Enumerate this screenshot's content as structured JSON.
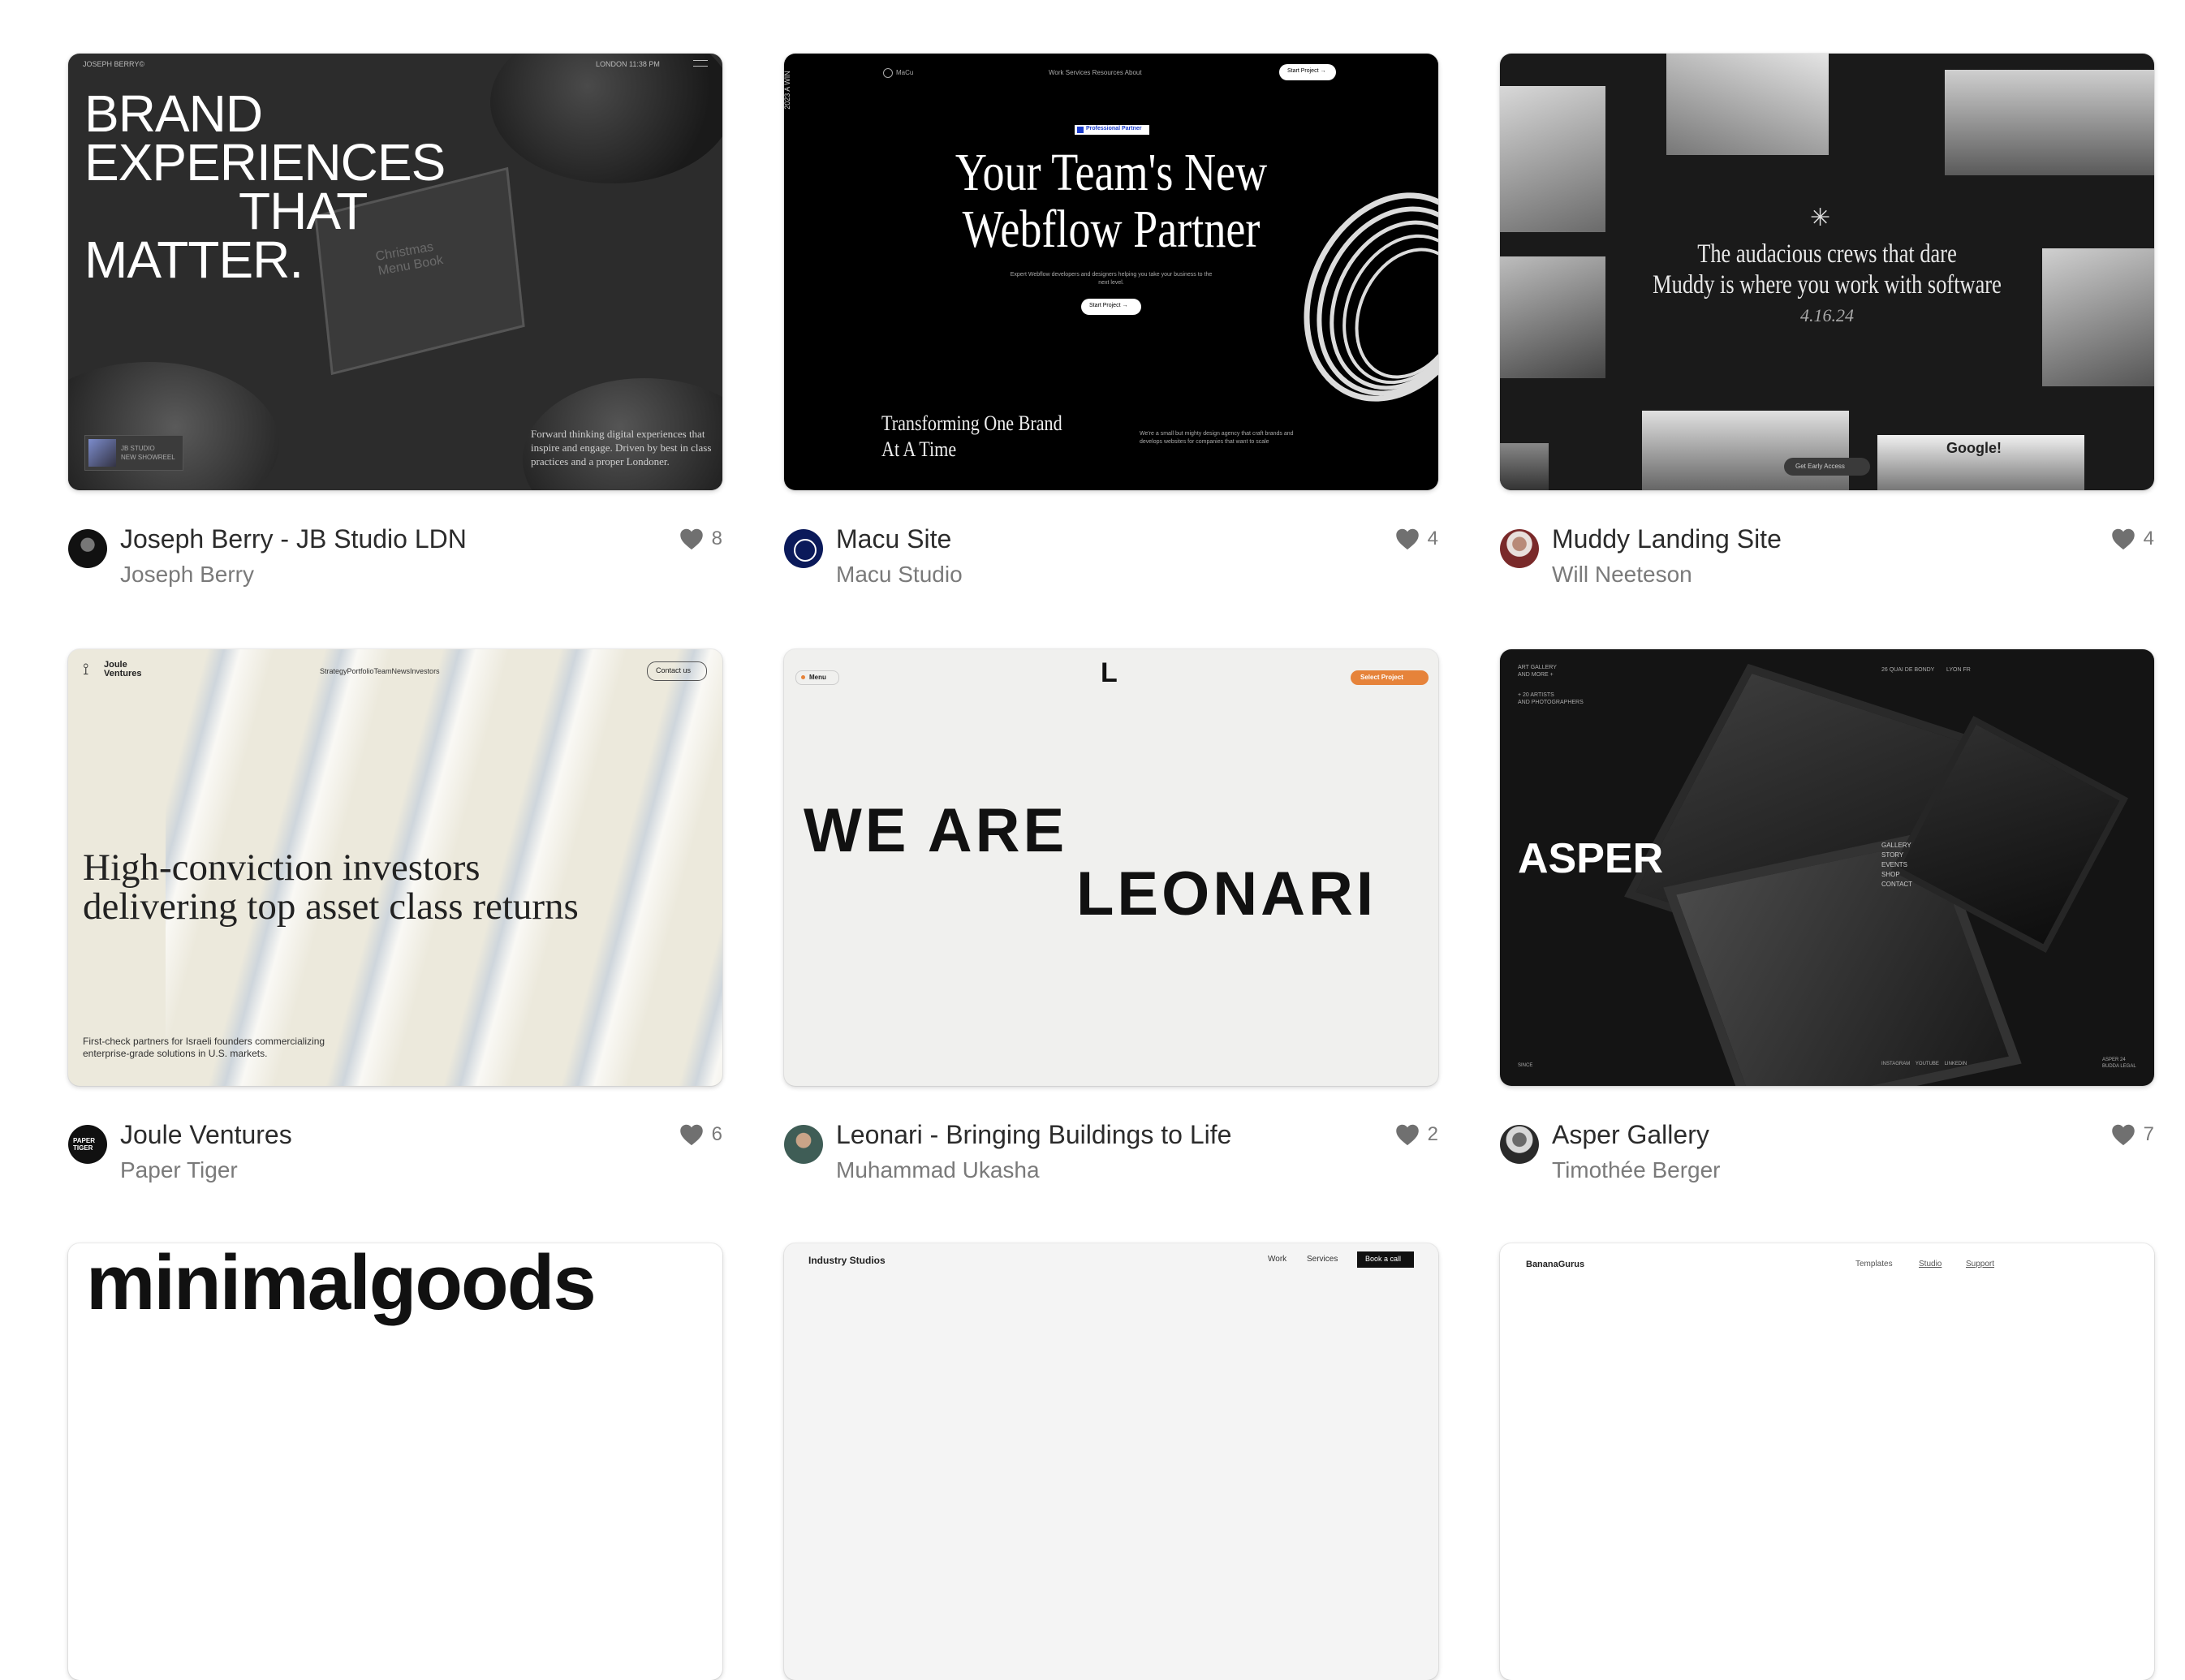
{
  "cards": [
    {
      "title": "Joseph Berry - JB Studio LDN",
      "author": "Joseph Berry",
      "likes": "8",
      "preview": {
        "header_left": "JOSEPH BERRY©",
        "header_mid": "LONDON 11:38 PM",
        "headline": [
          "BRAND",
          "EXPERIENCES",
          "THAT",
          "MATTER."
        ],
        "screen_text": [
          "Christmas",
          "Menu Book"
        ],
        "badge": [
          "JB STUDIO",
          "NEW SHOWREEL"
        ],
        "tagline": [
          "Forward thinking digital experiences that",
          "inspire and engage. Driven by best in class",
          "practices and a proper Londoner."
        ]
      }
    },
    {
      "title": "Macu Site",
      "author": "Macu Studio",
      "likes": "4",
      "preview": {
        "side_text": "2023 A WIN",
        "logo": "MaCu",
        "nav": "Work  Services  Resources  About",
        "cta": "Start Project →",
        "badge": "Professional Partner",
        "headline": [
          "Your Team's New",
          "Webflow Partner"
        ],
        "sub": [
          "Expert Webflow developers and designers helping you take your business to the",
          "next level."
        ],
        "button": "Start Project →",
        "footer_left": [
          "Transforming One Brand",
          "At A Time"
        ],
        "footer_right": [
          "We're a small but mighty design agency that craft brands and",
          "develops websites for companies that want to scale"
        ]
      }
    },
    {
      "title": "Muddy Landing Site",
      "author": "Will Neeteson",
      "likes": "4",
      "preview": {
        "headline": [
          "The audacious crews that dare",
          "Muddy is where you work with software"
        ],
        "date": "4.16.24",
        "button": "Get Early Access",
        "sign": "Google!"
      }
    },
    {
      "title": "Joule Ventures",
      "author": "Paper Tiger",
      "likes": "6",
      "preview": {
        "logo": [
          "Joule",
          "Ventures"
        ],
        "nav": "StrategyPortfolioTeamNewsInvestors",
        "cta": "Contact us",
        "headline": [
          "High-conviction investors",
          "delivering top asset class returns"
        ],
        "footer": [
          "First-check partners for Israeli founders commercializing",
          "enterprise-grade solutions in U.S. markets."
        ]
      }
    },
    {
      "title": "Leonari - Bringing Buildings to Life",
      "author": "Muhammad Ukasha",
      "likes": "2",
      "preview": {
        "menu": "Menu",
        "logo": "L",
        "cta": "Select Project",
        "headline": [
          "WE ARE",
          "LEONARI"
        ]
      }
    },
    {
      "title": "Asper Gallery",
      "author": "Timothée Berger",
      "likes": "7",
      "preview": {
        "top_left": [
          "ART GALLERY",
          "AND MORE +"
        ],
        "top_left2": [
          "+ 20 ARTISTS",
          "AND PHOTOGRAPHERS"
        ],
        "top_mid": "26 QUAI DE BONDY",
        "top_mid2": "LYON FR",
        "name": "ASPER",
        "menu": [
          "GALLERY",
          "STORY",
          "EVENTS",
          "SHOP",
          "CONTACT"
        ],
        "bottom_left": "SINCE",
        "bottom_links": [
          "INSTAGRAM",
          "YOUTUBE",
          "LINKEDIN"
        ],
        "bottom_right": [
          "ASPER 24",
          "BUDDA LEGAL"
        ]
      }
    },
    {
      "preview": {
        "headline": "minimalgoods"
      }
    },
    {
      "preview": {
        "logo": "Industry Studios",
        "nav": [
          "Work",
          "Services"
        ],
        "cta": "Book a call"
      }
    },
    {
      "preview": {
        "logo": "BananaGurus",
        "nav": [
          "Templates",
          "Studio",
          "Support"
        ]
      }
    }
  ],
  "colors": {
    "title": "#2b2b2b",
    "author": "#7a7a7a",
    "heart": "#707070",
    "leonari_accent": "#e6833a"
  }
}
